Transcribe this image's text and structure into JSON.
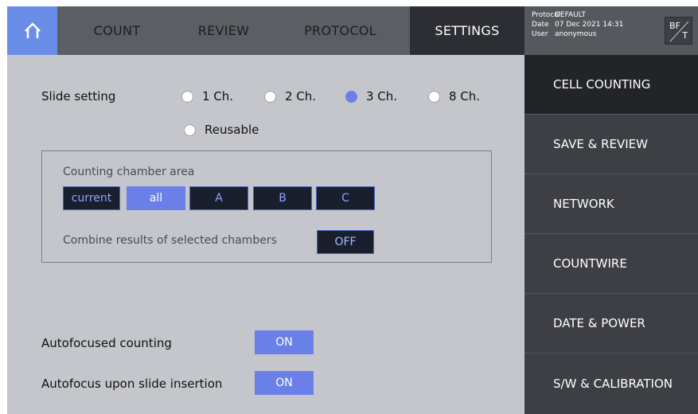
{
  "topbar": {
    "home_icon": "home-icon",
    "tabs": [
      {
        "label": "COUNT"
      },
      {
        "label": "REVIEW"
      },
      {
        "label": "PROTOCOL"
      },
      {
        "label": "SETTINGS"
      }
    ],
    "status": {
      "protocol_key": "Protocol",
      "protocol_value": "DEFAULT",
      "date_key": "Date",
      "date_value": "07 Dec 2021 14:31",
      "user_key": "User",
      "user_value": "anonymous"
    },
    "mode_badge": {
      "top": "BF",
      "bottom": "T"
    }
  },
  "sidebar": {
    "items": [
      {
        "label": "CELL COUNTING"
      },
      {
        "label": "SAVE & REVIEW"
      },
      {
        "label": "NETWORK"
      },
      {
        "label": "COUNTWIRE"
      },
      {
        "label": "DATE & POWER"
      },
      {
        "label": "S/W & CALIBRATION"
      }
    ]
  },
  "main": {
    "slide_setting_label": "Slide setting",
    "slide_options": [
      {
        "label": "1 Ch."
      },
      {
        "label": "2 Ch."
      },
      {
        "label": "3 Ch."
      },
      {
        "label": "8 Ch."
      },
      {
        "label": "Reusable"
      }
    ],
    "slide_selected": "3 Ch.",
    "chamber": {
      "title": "Counting chamber area",
      "chips": [
        {
          "label": "current"
        },
        {
          "label": "all"
        },
        {
          "label": "A"
        },
        {
          "label": "B"
        },
        {
          "label": "C"
        }
      ],
      "selected": "all",
      "combine_label": "Combine results of selected chambers",
      "combine_value": "OFF"
    },
    "autofocused_label": "Autofocused counting",
    "autofocused_value": "ON",
    "autofocus_insert_label": "Autofocus upon slide insertion",
    "autofocus_insert_value": "ON"
  },
  "colors": {
    "accent": "#6a80e8",
    "background": "#c4c6cb",
    "sidebar": "#3d3f44",
    "topbar": "#5b5e63"
  }
}
